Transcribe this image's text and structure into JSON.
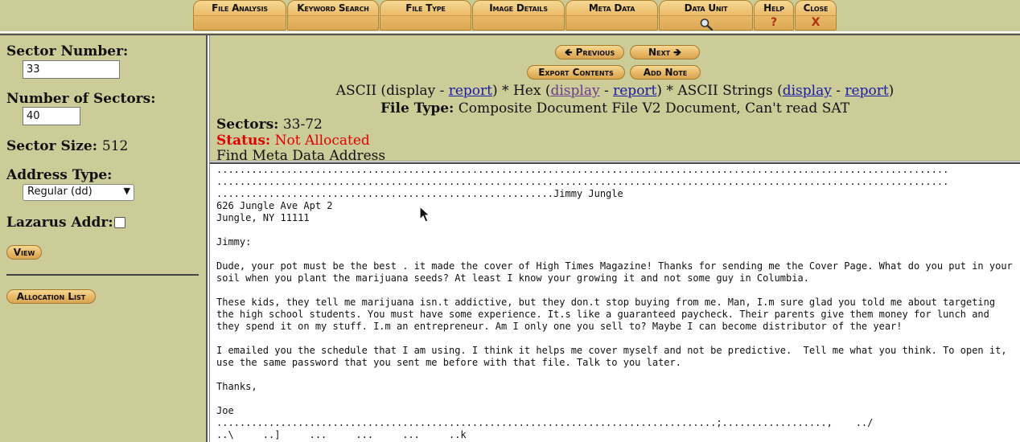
{
  "toolbar": {
    "tabs": [
      {
        "label": "File Analysis"
      },
      {
        "label": "Keyword Search"
      },
      {
        "label": "File Type"
      },
      {
        "label": "Image Details"
      },
      {
        "label": "Meta Data"
      },
      {
        "label": "Data Unit"
      },
      {
        "label": "Help",
        "glyph": "?"
      },
      {
        "label": "Close",
        "glyph": "X"
      }
    ]
  },
  "sidebar": {
    "sector_number_label": "Sector Number:",
    "sector_number_value": "33",
    "num_sectors_label": "Number of Sectors:",
    "num_sectors_value": "40",
    "sector_size_label": "Sector Size:",
    "sector_size_value": "512",
    "address_type_label": "Address Type:",
    "address_type_value": "Regular (dd)",
    "lazarus_label": "Lazarus Addr:",
    "view_button": "View",
    "allocation_button": "Allocation List"
  },
  "header": {
    "prev_button": "Previous",
    "next_button": "Next",
    "export_button": "Export Contents",
    "add_note_button": "Add Note",
    "ascii_label": "ASCII (display - ",
    "ascii_report": "report",
    "ascii_close": ") * Hex (",
    "hex_display": "display",
    "hex_sep": " - ",
    "hex_report": "report",
    "hex_close": ") * ASCII Strings (",
    "strings_display": "display",
    "strings_sep": " - ",
    "strings_report": "report",
    "strings_close": ")",
    "file_type_label": "File Type:",
    "file_type_value": "Composite Document File V2 Document, Can't read SAT",
    "sectors_label": "Sectors:",
    "sectors_value": "33-72",
    "status_label": "Status:",
    "status_value": "Not Allocated",
    "find_meta_link": "Find Meta Data Address",
    "colors": {
      "status": "#e00000",
      "link": "#1a1aa6",
      "visited": "#6a3c8c",
      "panel": "#cccc99",
      "button": "#e6b563"
    }
  },
  "content": {
    "text": "..............................................................................................................................\n..............................................................................................................................\n..........................................................Jimmy Jungle\n626 Jungle Ave Apt 2\nJungle, NY 11111\n\nJimmy:\n\nDude, your pot must be the best . it made the cover of High Times Magazine! Thanks for sending me the Cover Page. What do you put in your\nsoil when you plant the marijuana seeds? At least I know your growing it and not some guy in Columbia.\n\nThese kids, they tell me marijuana isn.t addictive, but they don.t stop buying from me. Man, I.m sure glad you told me about targeting\nthe high school students. You must have some experience. It.s like a guaranteed paycheck. Their parents give them money for lunch and\nthey spend it on my stuff. I.m an entrepreneur. Am I only one you sell to? Maybe I can become distributor of the year!\n\nI emailed you the schedule that I am using. I think it helps me cover myself and not be predictive.  Tell me what you think. To open it,\nuse the same password that you sent me before with that file. Talk to you later.\n\nThanks,\n\nJoe\n......................................................................................;..................,    ../\n..\\     ..]     ...     ...     ...     ..k\n..l"
  }
}
